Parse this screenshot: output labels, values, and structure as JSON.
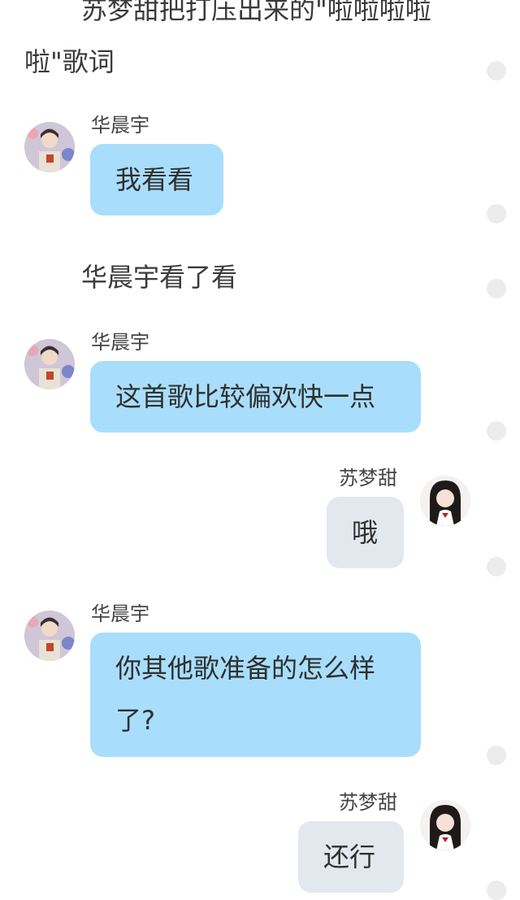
{
  "narration": {
    "top_line1": "苏梦甜把打压出来的\"啦啦啦啦",
    "top_line2": "啦\"歌词",
    "mid": "华晨宇看了看"
  },
  "messages": [
    {
      "sender": "华晨宇",
      "side": "left",
      "text": "我看看"
    },
    {
      "sender": "华晨宇",
      "side": "left",
      "text": "这首歌比较偏欢快一点"
    },
    {
      "sender": "苏梦甜",
      "side": "right",
      "text": "哦"
    },
    {
      "sender": "华晨宇",
      "side": "left",
      "text_line1": "你其他歌准备的怎么样",
      "text_line2": "了?"
    },
    {
      "sender": "苏梦甜",
      "side": "right",
      "text": "还行"
    }
  ],
  "colors": {
    "left_bubble": "#a8defb",
    "right_bubble": "#e3e8ef",
    "marker": "#ececec"
  },
  "icons": {
    "avatar_left": "male-avatar-photo",
    "avatar_right": "female-avatar-photo",
    "marker": "circle-marker-icon"
  }
}
